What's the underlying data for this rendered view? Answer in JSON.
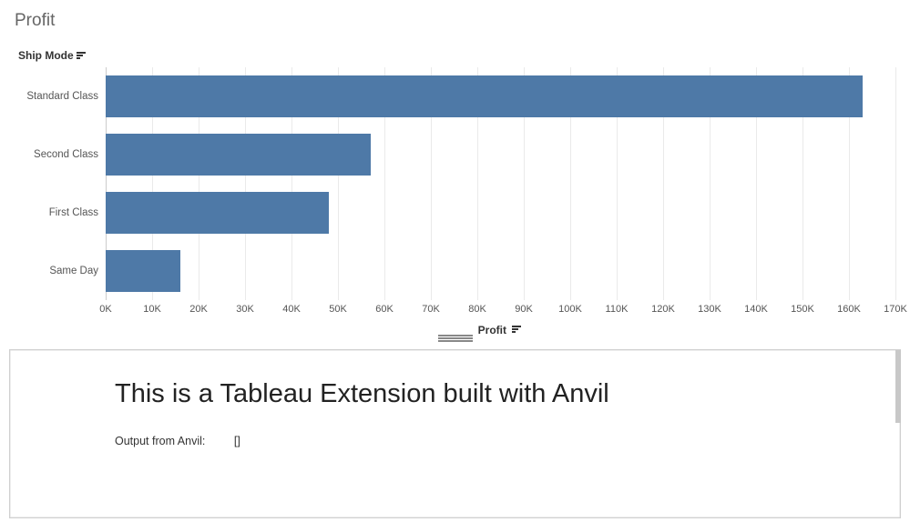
{
  "chart_data": {
    "type": "bar",
    "orientation": "horizontal",
    "title": "Profit",
    "y_axis_label": "Ship Mode",
    "x_axis_label": "Profit",
    "xlim": [
      0,
      170000
    ],
    "x_ticks": [
      0,
      10000,
      20000,
      30000,
      40000,
      50000,
      60000,
      70000,
      80000,
      90000,
      100000,
      110000,
      120000,
      130000,
      140000,
      150000,
      160000,
      170000
    ],
    "x_tick_labels": [
      "0K",
      "10K",
      "20K",
      "30K",
      "40K",
      "50K",
      "60K",
      "70K",
      "80K",
      "90K",
      "100K",
      "110K",
      "120K",
      "130K",
      "140K",
      "150K",
      "160K",
      "170K"
    ],
    "categories": [
      "Standard Class",
      "Second Class",
      "First Class",
      "Same Day"
    ],
    "values": [
      163000,
      57000,
      48000,
      16000
    ],
    "bar_color": "#4e79a7"
  },
  "extension": {
    "title": "This is a Tableau Extension built with Anvil",
    "output_label": "Output from Anvil:",
    "output_value": "[]"
  }
}
